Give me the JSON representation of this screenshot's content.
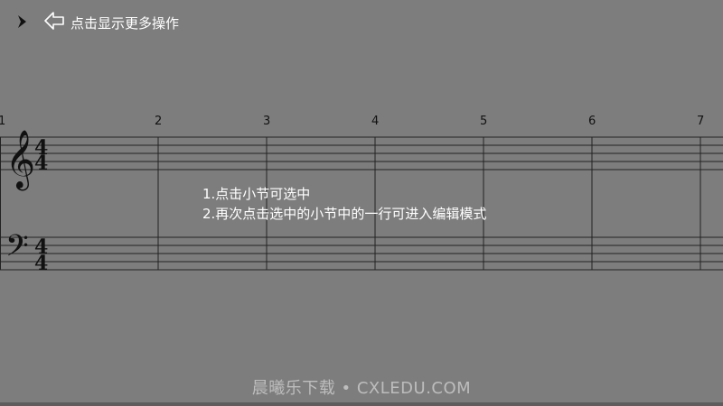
{
  "toolbar": {
    "expand_icon": "chevron-right-icon",
    "back_icon": "back-arrow-icon",
    "hint_label": "点击显示更多操作"
  },
  "score": {
    "measure_numbers": [
      "1",
      "2",
      "3",
      "4",
      "5",
      "6",
      "7"
    ],
    "treble_time_signature": {
      "top": "4",
      "bottom": "4"
    },
    "bass_time_signature": {
      "top": "4",
      "bottom": "4"
    }
  },
  "instructions": {
    "line1": "1.点击小节可选中",
    "line2": "2.再次点击选中的小节中的一行可进入编辑模式"
  },
  "watermark": "晨曦乐下载 • CXLEDU.COM"
}
